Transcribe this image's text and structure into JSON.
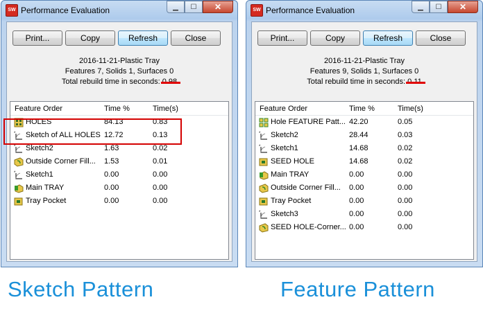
{
  "windows": [
    {
      "title": "Performance Evaluation",
      "buttons": [
        "Print...",
        "Copy",
        "Refresh",
        "Close"
      ],
      "info": {
        "line1": "2016-11-21-Plastic Tray",
        "line2": "Features 7, Solids 1, Surfaces 0",
        "line3_label": "Total rebuild time in seconds:",
        "line3_value": "0.98"
      },
      "columns": [
        "Feature Order",
        "Time %",
        "Time(s)"
      ],
      "rows": [
        {
          "icon": "holes-feature-icon",
          "name": "HOLES",
          "pct": "84.13",
          "time": "0.83"
        },
        {
          "icon": "sketch-icon",
          "name": "Sketch of ALL HOLES",
          "pct": "12.72",
          "time": "0.13"
        },
        {
          "icon": "sketch-icon",
          "name": "Sketch2",
          "pct": "1.63",
          "time": "0.02"
        },
        {
          "icon": "fillet-feature-icon",
          "name": "Outside Corner Fill...",
          "pct": "1.53",
          "time": "0.01"
        },
        {
          "icon": "sketch-icon",
          "name": "Sketch1",
          "pct": "0.00",
          "time": "0.00"
        },
        {
          "icon": "extrude-feature-icon",
          "name": "Main TRAY",
          "pct": "0.00",
          "time": "0.00"
        },
        {
          "icon": "cut-feature-icon",
          "name": "Tray Pocket",
          "pct": "0.00",
          "time": "0.00"
        }
      ]
    },
    {
      "title": "Performance Evaluation",
      "buttons": [
        "Print...",
        "Copy",
        "Refresh",
        "Close"
      ],
      "info": {
        "line1": "2016-11-21-Plastic Tray",
        "line2": "Features 9, Solids 1, Surfaces 0",
        "line3_label": "Total rebuild time in seconds:",
        "line3_value": "0.11"
      },
      "columns": [
        "Feature Order",
        "Time %",
        "Time(s)"
      ],
      "rows": [
        {
          "icon": "pattern-feature-icon",
          "name": "Hole FEATURE Patt...",
          "pct": "42.20",
          "time": "0.05"
        },
        {
          "icon": "sketch-icon",
          "name": "Sketch2",
          "pct": "28.44",
          "time": "0.03"
        },
        {
          "icon": "sketch-icon",
          "name": "Sketch1",
          "pct": "14.68",
          "time": "0.02"
        },
        {
          "icon": "cut-feature-icon",
          "name": "SEED HOLE",
          "pct": "14.68",
          "time": "0.02"
        },
        {
          "icon": "extrude-feature-icon",
          "name": "Main TRAY",
          "pct": "0.00",
          "time": "0.00"
        },
        {
          "icon": "fillet-feature-icon",
          "name": "Outside Corner Fill...",
          "pct": "0.00",
          "time": "0.00"
        },
        {
          "icon": "cut-feature-icon",
          "name": "Tray Pocket",
          "pct": "0.00",
          "time": "0.00"
        },
        {
          "icon": "sketch-icon",
          "name": "Sketch3",
          "pct": "0.00",
          "time": "0.00"
        },
        {
          "icon": "fillet-feature-icon",
          "name": "SEED HOLE-Corner...",
          "pct": "0.00",
          "time": "0.00"
        }
      ]
    }
  ],
  "captions": {
    "left": "Sketch Pattern",
    "right": "Feature Pattern"
  },
  "colors": {
    "caption": "#1a90d9",
    "highlight": "#d40000"
  }
}
